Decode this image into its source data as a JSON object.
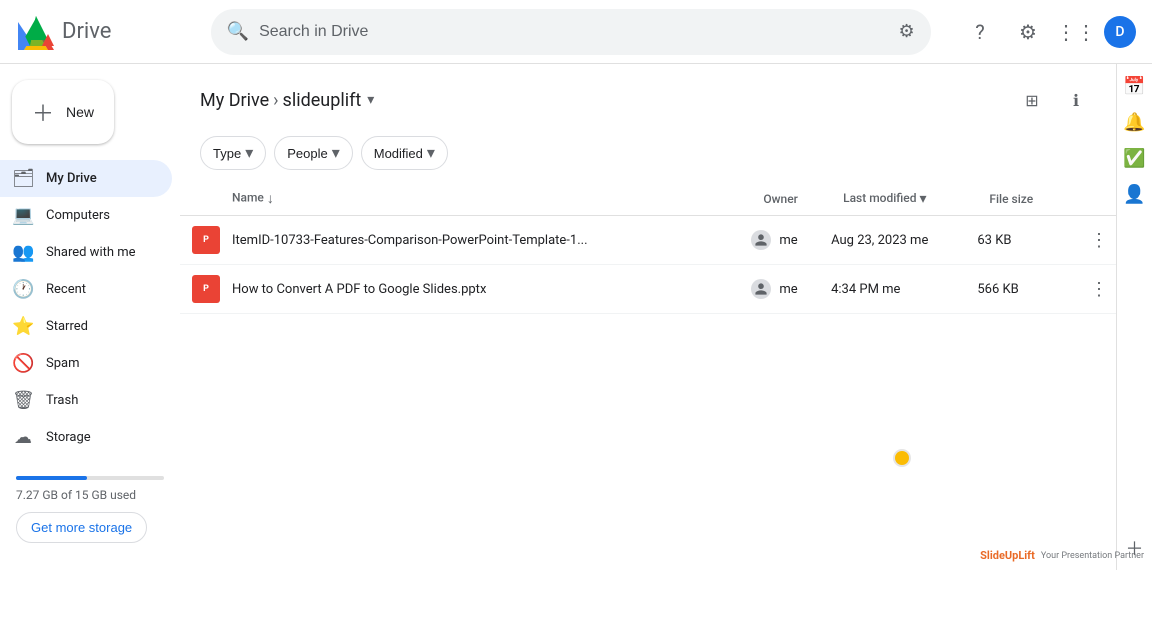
{
  "topbar": {
    "app_name": "Drive",
    "search_placeholder": "Search in Drive",
    "user_initial": "D"
  },
  "sidebar": {
    "new_label": "New",
    "nav_items": [
      {
        "id": "my-drive",
        "label": "My Drive",
        "icon": "🗂"
      },
      {
        "id": "computers",
        "label": "Computers",
        "icon": "💻"
      },
      {
        "id": "shared",
        "label": "Shared with me",
        "icon": "👥"
      },
      {
        "id": "recent",
        "label": "Recent",
        "icon": "🕐"
      },
      {
        "id": "starred",
        "label": "Starred",
        "icon": "⭐"
      },
      {
        "id": "spam",
        "label": "Spam",
        "icon": "🚫"
      },
      {
        "id": "trash",
        "label": "Trash",
        "icon": "🗑"
      },
      {
        "id": "storage",
        "label": "Storage",
        "icon": "☁"
      }
    ],
    "storage": {
      "text": "7.27 GB of 15 GB used",
      "fill_percent": 48,
      "get_more_label": "Get more storage"
    }
  },
  "breadcrumb": {
    "my_drive_label": "My Drive",
    "separator": "›",
    "folder_name": "slideuplift",
    "dropdown_icon": "▾"
  },
  "filters": [
    {
      "label": "Type",
      "id": "type-filter"
    },
    {
      "label": "People",
      "id": "people-filter"
    },
    {
      "label": "Modified",
      "id": "modified-filter"
    }
  ],
  "table": {
    "headers": [
      {
        "id": "name",
        "label": "Name",
        "sort_icon": "↓"
      },
      {
        "id": "owner",
        "label": "Owner"
      },
      {
        "id": "last_modified",
        "label": "Last modified",
        "sort_icon": "▾"
      },
      {
        "id": "file_size",
        "label": "File size"
      }
    ],
    "rows": [
      {
        "id": "file-1",
        "name": "ItemID-10733-Features-Comparison-PowerPoint-Template-1...",
        "type": "pptx",
        "owner": "me",
        "last_modified": "Aug 23, 2023 me",
        "file_size": "63 KB"
      },
      {
        "id": "file-2",
        "name": "How to Convert A PDF to Google Slides.pptx",
        "type": "pptx",
        "owner": "me",
        "last_modified": "4:34 PM  me",
        "file_size": "566 KB"
      }
    ]
  },
  "right_sidebar": {
    "icons": [
      "📅",
      "🔔",
      "✅",
      "👤"
    ],
    "add_icon": "+"
  },
  "watermark": {
    "brand": "SlideUpLift",
    "tagline": "Your Presentation Partner"
  }
}
